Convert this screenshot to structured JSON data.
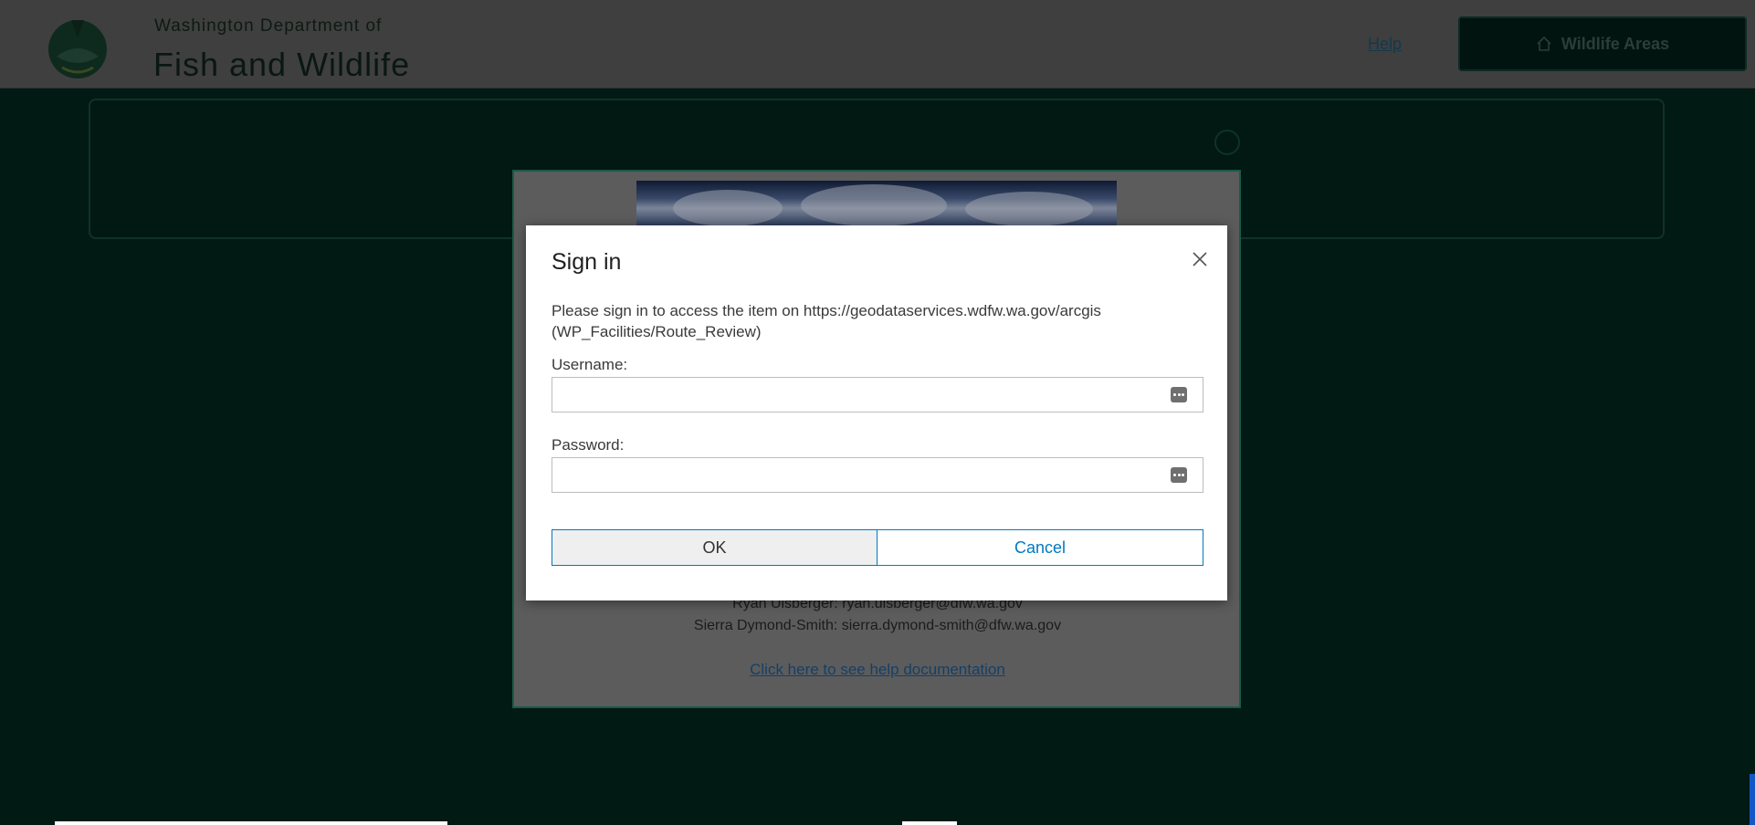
{
  "header": {
    "dept_line": "Washington Department of",
    "dept_name": "Fish and Wildlife",
    "help_label": "Help",
    "wildlife_button_label": "Wildlife Areas",
    "wildlife_button_icon": "home-icon"
  },
  "intro": {
    "contacts": [
      "Ryan Ulsberger: ryan.ulsberger@dfw.wa.gov",
      "Sierra Dymond-Smith: sierra.dymond-smith@dfw.wa.gov"
    ],
    "help_doc_link": "Click here to see help documentation"
  },
  "dialog": {
    "title": "Sign in",
    "message": "Please sign in to access the item on https://geodataservices.wdfw.wa.gov/arcgis (WP_Facilities/Route_Review)",
    "username_label": "Username:",
    "username_value": "",
    "password_label": "Password:",
    "password_value": "",
    "ok_label": "OK",
    "cancel_label": "Cancel"
  },
  "colors": {
    "accent": "#0079c1",
    "overlay_background": "#021a14",
    "dialog_background": "#ffffff"
  }
}
